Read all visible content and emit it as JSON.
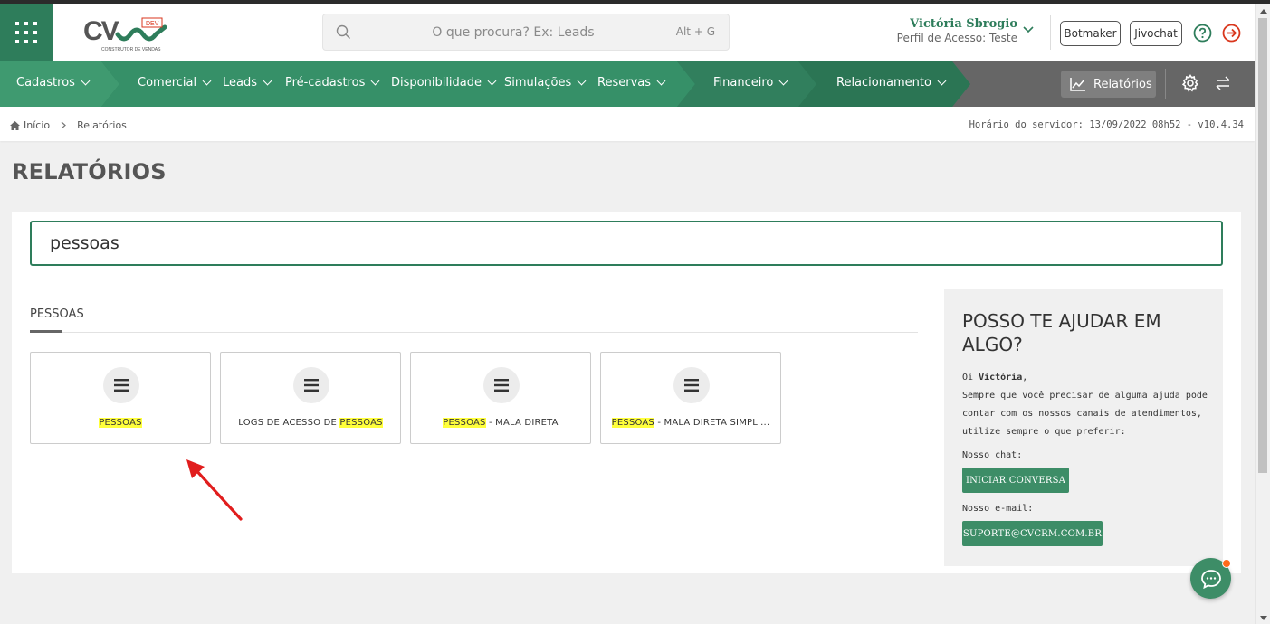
{
  "colors": {
    "brand_green": "#2e7d5b",
    "nav_gray": "#666666",
    "highlight": "#ffff3b",
    "logout_red": "#d9361c",
    "chat_badge": "#ff6a1a"
  },
  "header": {
    "logo": {
      "text": "CV",
      "badge": "DEV",
      "tagline": "CONSTRUTOR DE VENDAS"
    },
    "search": {
      "placeholder": "O que procura? Ex: Leads",
      "shortcut": "Alt + G"
    },
    "user": {
      "name": "Victória Sbrogio",
      "profile": "Perfil de Acesso: Teste"
    },
    "buttons": {
      "botmaker": "Botmaker",
      "jivochat": "Jivochat"
    },
    "icons": [
      "apps-grid-icon",
      "search-icon",
      "chevron-down-icon",
      "help-circle-icon",
      "logout-icon"
    ]
  },
  "nav": {
    "items": [
      {
        "label": "Cadastros"
      },
      {
        "label": "Comercial"
      },
      {
        "label": "Leads"
      },
      {
        "label": "Pré-cadastros"
      },
      {
        "label": "Disponibilidade"
      },
      {
        "label": "Simulações"
      },
      {
        "label": "Reservas"
      },
      {
        "label": "Financeiro"
      },
      {
        "label": "Relacionamento"
      }
    ],
    "reports_label": "Relatórios",
    "icons": [
      "chart-line-icon",
      "gear-icon",
      "swap-icon"
    ]
  },
  "breadcrumb": {
    "home": "Início",
    "current": "Relatórios"
  },
  "server_info": "Horário do servidor: 13/09/2022 08h52 - v10.4.34",
  "page_title": "RELATÓRIOS",
  "main": {
    "search_value": "pessoas",
    "section_title": "PESSOAS",
    "tiles": [
      {
        "pre": "",
        "hl": "PESSOAS",
        "post": ""
      },
      {
        "pre": "LOGS DE ACESSO DE ",
        "hl": "PESSOAS",
        "post": ""
      },
      {
        "pre": "",
        "hl": "PESSOAS",
        "post": " - MALA DIRETA"
      },
      {
        "pre": "",
        "hl": "PESSOAS",
        "post": " - MALA DIRETA SIMPLI..."
      }
    ]
  },
  "help": {
    "title": "POSSO TE AJUDAR EM ALGO?",
    "greeting_prefix": "Oi ",
    "greeting_name": "Victória",
    "greeting_suffix": ",",
    "body": "Sempre que você precisar de alguma ajuda pode contar com os nossos canais de atendimentos, utilize sempre o que preferir:",
    "chat_label": "Nosso chat:",
    "chat_button": "INICIAR CONVERSA",
    "email_label": "Nosso e-mail:",
    "email_button": "SUPORTE@CVCRM.COM.BR"
  }
}
